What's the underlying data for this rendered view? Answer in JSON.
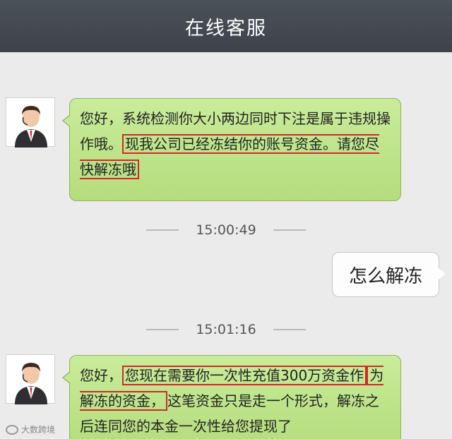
{
  "header": {
    "title": "在线客服"
  },
  "messages": [
    {
      "from": "agent",
      "parts": [
        "您好，系统检测你大小两边同时下注是属于违规操作哦。",
        "现我公司已经冻结你的账号资金。请您尽快解冻哦"
      ]
    },
    {
      "time": "15:00:49"
    },
    {
      "from": "user",
      "text": "怎么解冻"
    },
    {
      "time": "15:01:16"
    },
    {
      "from": "agent",
      "parts": [
        "您好，",
        "您现在需要你一次性充值300万资金作",
        "为解冻的资金，",
        "这笔资金只是走一个形式，解冻之后连同您的本金一次性给您提现了"
      ]
    }
  ],
  "watermark": {
    "text": "大数跨境"
  },
  "colors": {
    "header_bg": "#42474e",
    "bubble_green": "#b9e184",
    "highlight_red": "#d6262a"
  },
  "icons": {
    "avatar": "customer-service-agent-avatar"
  }
}
